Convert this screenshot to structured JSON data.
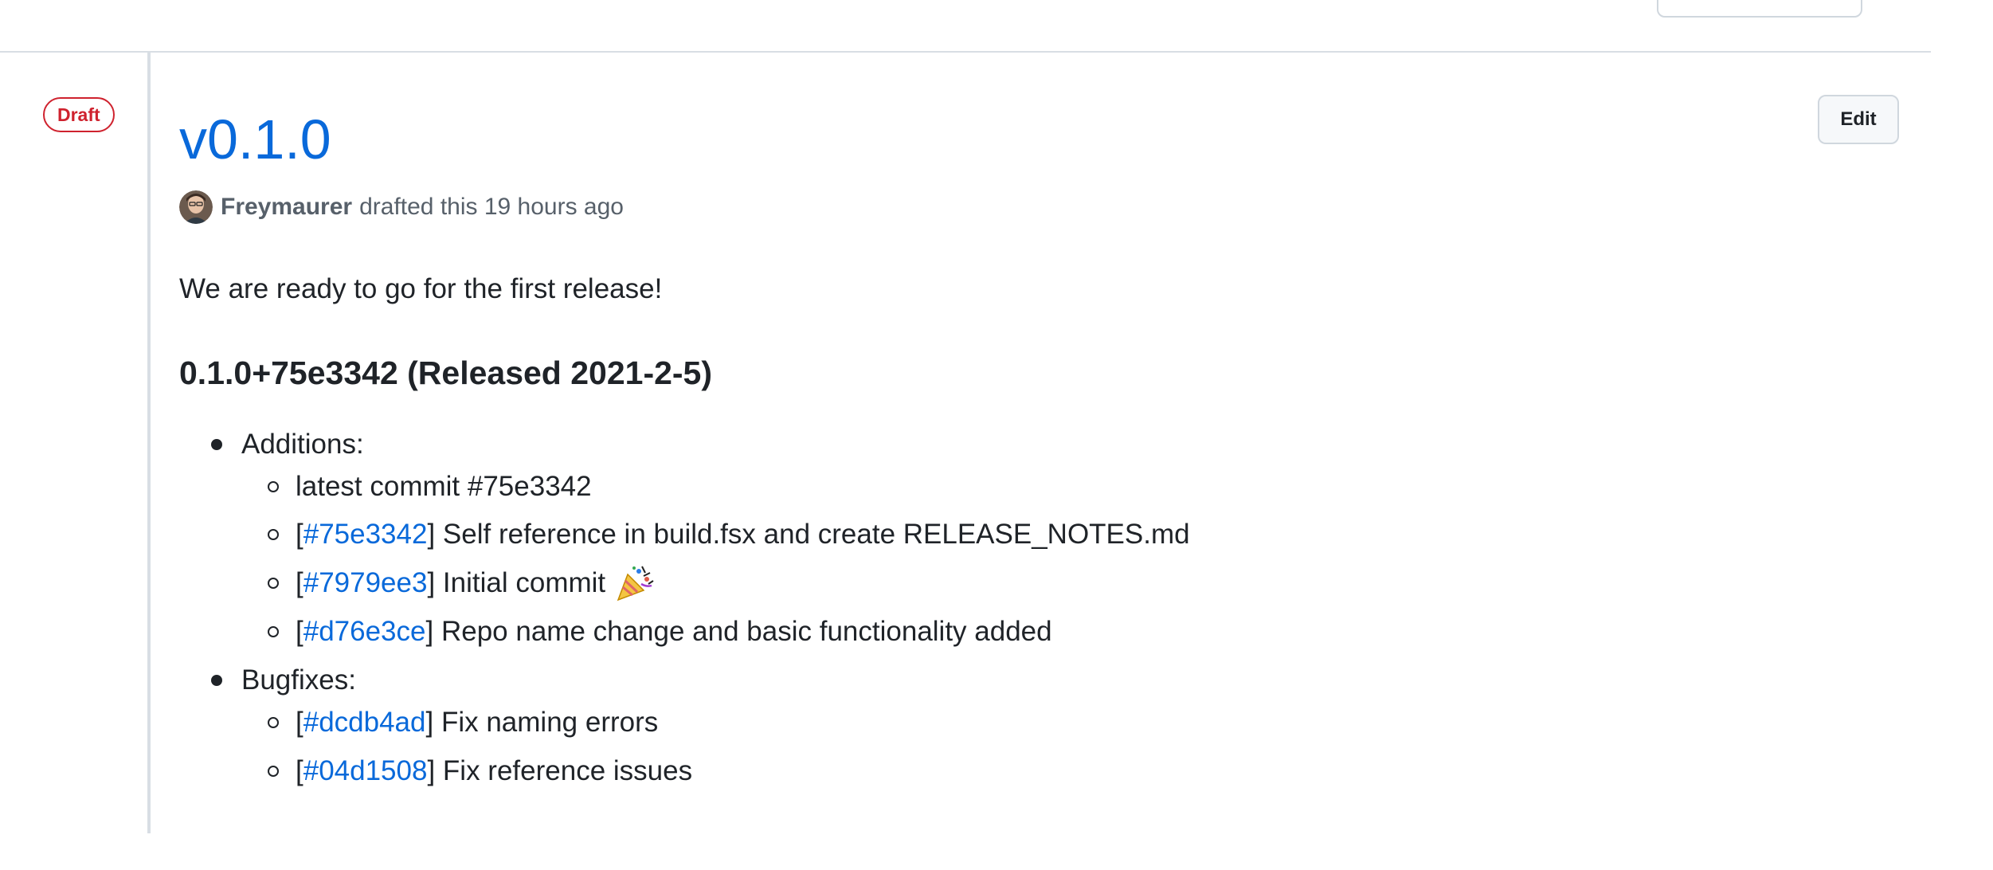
{
  "release": {
    "badge": "Draft",
    "title": "v0.1.0",
    "edit_label": "Edit",
    "author": "Freymaurer",
    "drafted_text": "drafted this 19 hours ago",
    "intro": "We are ready to go for the first release!",
    "version_heading": "0.1.0+75e3342 (Released 2021-2-5)"
  },
  "notes": {
    "sections": [
      {
        "label": "Additions:",
        "items": [
          {
            "link": "",
            "prefix": "",
            "suffix": "",
            "text": "latest commit #75e3342"
          },
          {
            "prefix": "[",
            "link": "#75e3342",
            "suffix": "]",
            "text": " Self reference in build.fsx and create RELEASE_NOTES.md"
          },
          {
            "prefix": "[",
            "link": "#7979ee3",
            "suffix": "]",
            "text": " Initial commit",
            "emoji": "party-popper-icon"
          },
          {
            "prefix": "[",
            "link": "#d76e3ce",
            "suffix": "]",
            "text": " Repo name change and basic functionality added"
          }
        ]
      },
      {
        "label": "Bugfixes:",
        "items": [
          {
            "prefix": "[",
            "link": "#dcdb4ad",
            "suffix": "]",
            "text": " Fix naming errors"
          },
          {
            "prefix": "[",
            "link": "#04d1508",
            "suffix": "]",
            "text": " Fix reference issues"
          }
        ]
      }
    ]
  },
  "colors": {
    "link": "#0969da",
    "draft": "#cf222e",
    "text": "#1f2328",
    "muted": "#57606a",
    "border": "#d0d7de"
  }
}
